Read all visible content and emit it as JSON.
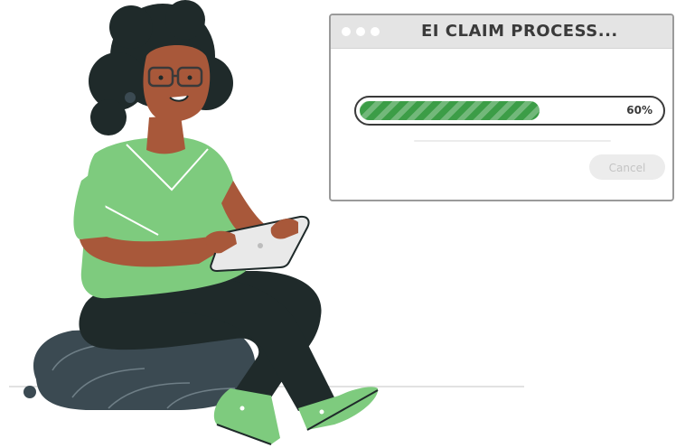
{
  "window": {
    "title": "EI CLAIM PROCESS...",
    "progress": {
      "value": 0.6,
      "label": "60%"
    },
    "cancel_label": "Cancel"
  },
  "colors": {
    "progress_fill": "#3c9d47",
    "shirt": "#7ecb7e",
    "shoes": "#7ecb7e",
    "pants": "#1f2a2a",
    "cushion": "#3b4a52",
    "hair": "#1f2a2a",
    "skin": "#a8583a"
  }
}
